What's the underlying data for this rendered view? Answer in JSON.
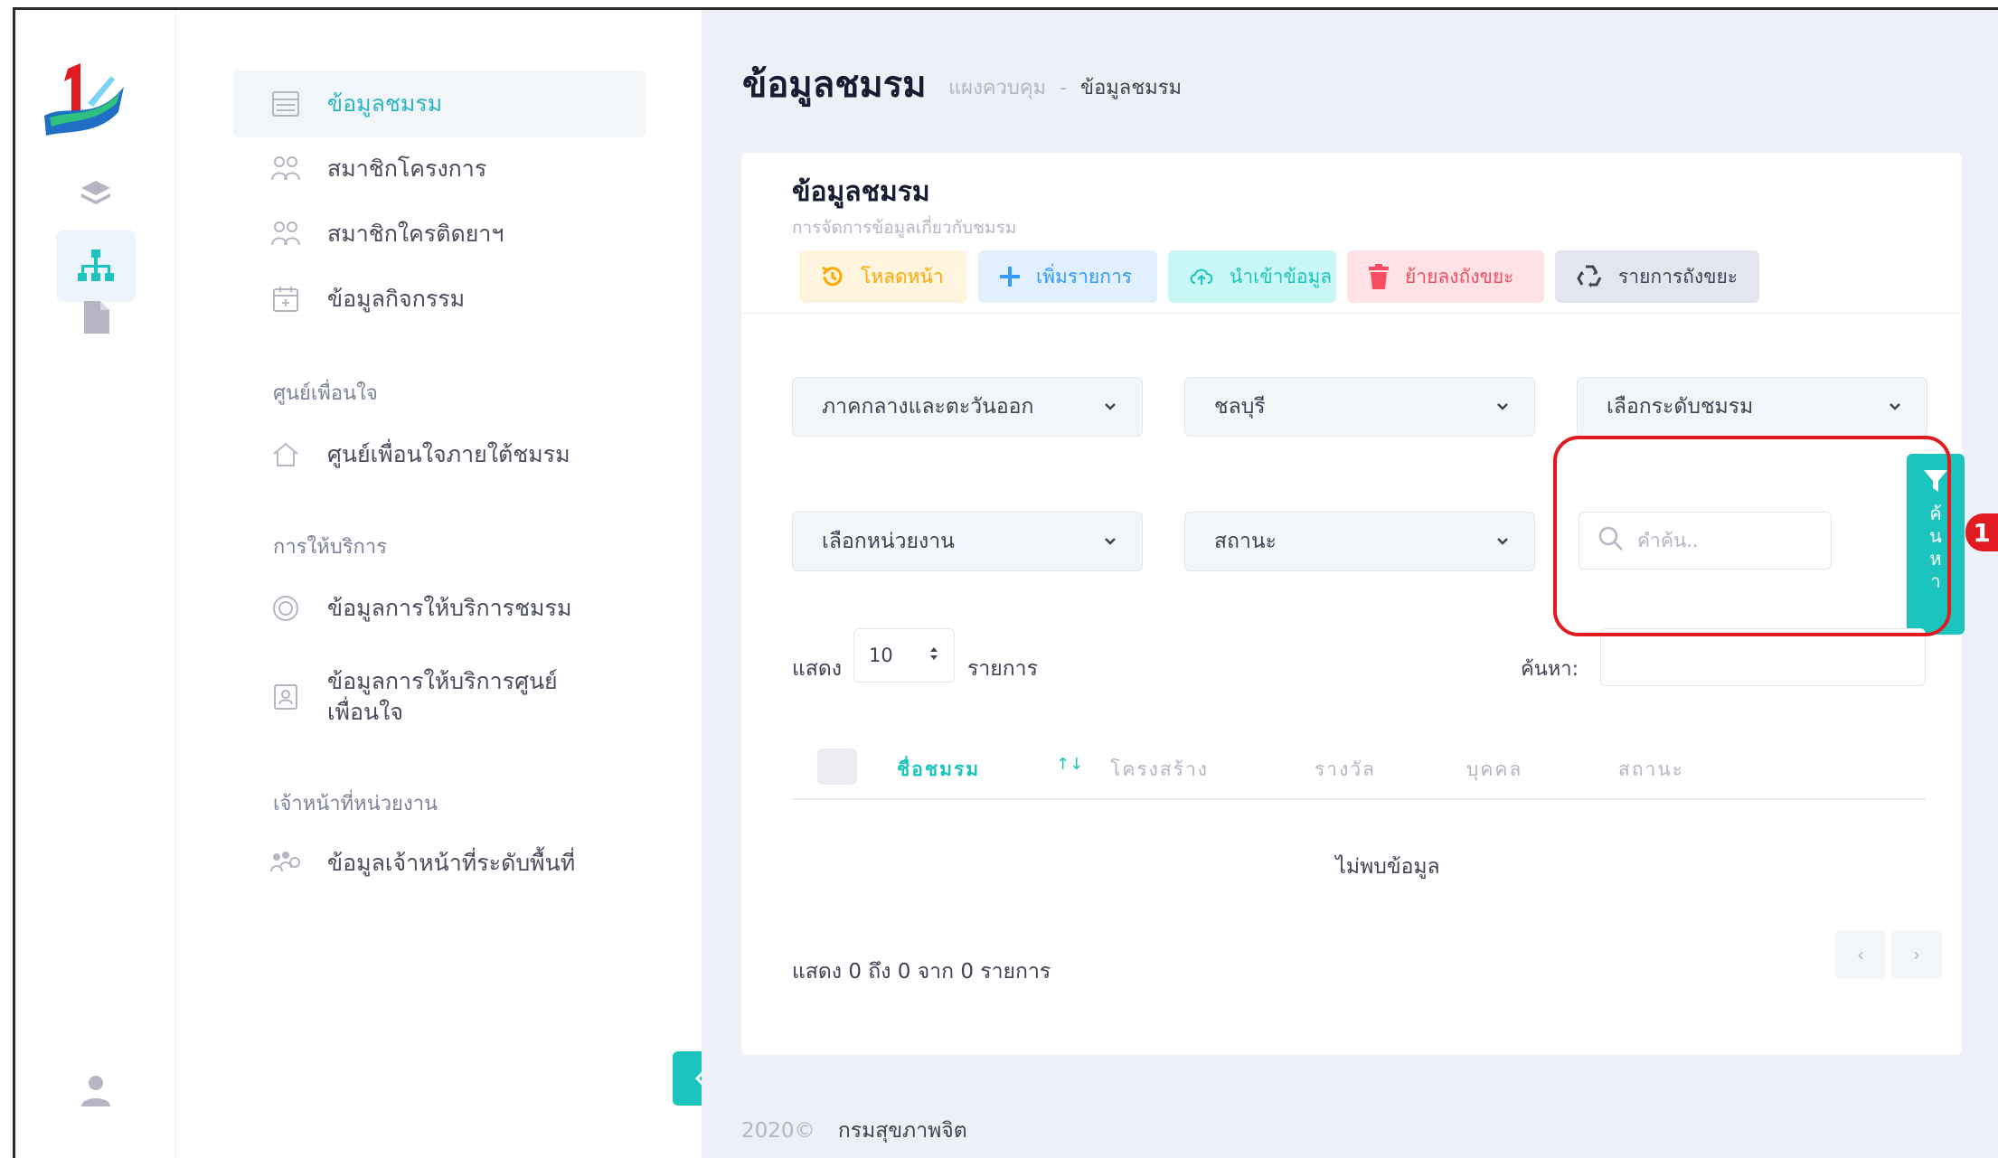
{
  "sidebar": {
    "items": [
      {
        "label": "ข้อมูลชมรม",
        "icon": "table-icon"
      },
      {
        "label": "สมาชิกโครงการ",
        "icon": "members-icon"
      },
      {
        "label": "สมาชิกใครติดยาฯ",
        "icon": "members-icon"
      },
      {
        "label": "ข้อมูลกิจกรรม",
        "icon": "calendar-icon"
      }
    ],
    "sections": [
      {
        "title": "ศูนย์เพื่อนใจ",
        "items": [
          {
            "label": "ศูนย์เพื่อนใจภายใต้ชมรม",
            "icon": "home-icon"
          }
        ]
      },
      {
        "title": "การให้บริการ",
        "items": [
          {
            "label": "ข้อมูลการให้บริการชมรม",
            "icon": "target-icon"
          },
          {
            "label": "ข้อมูลการให้บริการศูนย์เพื่อนใจ",
            "icon": "id-card-icon"
          }
        ]
      },
      {
        "title": "เจ้าหน้าที่หน่วยงาน",
        "items": [
          {
            "label": "ข้อมูลเจ้าหน้าที่ระดับพื้นที่",
            "icon": "staff-icon"
          }
        ]
      }
    ]
  },
  "header": {
    "title": "ข้อมูลชมรม",
    "breadcrumb": [
      "แผงควบคุม",
      "ข้อมูลชมรม"
    ]
  },
  "card": {
    "title": "ข้อมูลชมรม",
    "subtitle": "การจัดการข้อมูลเกี่ยวกับชมรม",
    "toolbar": {
      "reload": "โหลดหน้า",
      "add": "เพิ่มรายการ",
      "import": "นำเข้าข้อมูล",
      "trash": "ย้ายลงถังขยะ",
      "trash_list": "รายการถังขยะ"
    },
    "filters": {
      "region": "ภาคกลางและตะวันออก",
      "province": "ชลบุรี",
      "club_level": "เลือกระดับชมรม",
      "agency": "เลือกหน่วยงาน",
      "status": "สถานะ",
      "search_placeholder": "คำค้น..",
      "search_button_chars": [
        "ค",
        "้",
        "น",
        "ห",
        "า"
      ]
    },
    "marker": "1",
    "table": {
      "show_label": "แสดง",
      "page_length": "10",
      "entries_label": "รายการ",
      "search_label": "ค้นหา:",
      "columns": [
        "ชื่อชมรม",
        "โครงสร้าง",
        "รางวัล",
        "บุคคล",
        "สถานะ"
      ],
      "sort_indicator": "↑↓",
      "empty_message": "ไม่พบข้อมูล",
      "info": "แสดง 0 ถึง 0 จาก 0 รายการ",
      "prev": "‹",
      "next": "›"
    }
  },
  "footer": {
    "year": "2020©",
    "org": "กรมสุขภาพจิต"
  },
  "colors": {
    "accent": "#1bc5bd",
    "highlight": "#e21b23",
    "active_text": "#2bb6c5"
  }
}
